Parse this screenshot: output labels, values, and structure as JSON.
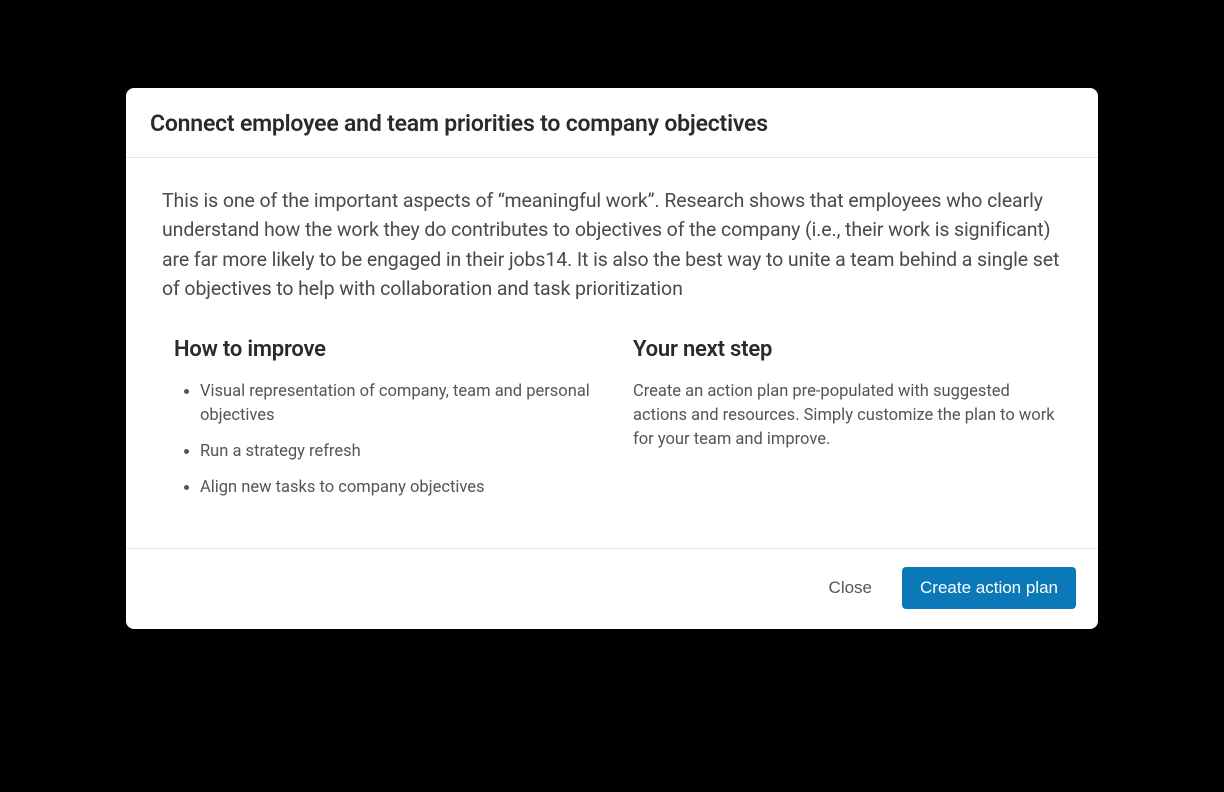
{
  "modal": {
    "title": "Connect employee and team priorities to company objectives",
    "intro": "This is one of the important aspects of “meaningful work”. Research shows that employees who clearly understand how the work they do contributes to objectives of the company (i.e., their work is significant) are far more likely to be engaged in their jobs14. It is also the best way to unite a team behind a single set of objectives to help with collaboration and task prioritization",
    "improve": {
      "heading": "How to improve",
      "items": [
        "Visual representation of company, team and personal objectives",
        "Run a strategy refresh",
        "Align new tasks to company objectives"
      ]
    },
    "next": {
      "heading": "Your next step",
      "body": "Create an action plan pre-populated with suggested actions and resources. Simply customize the plan to work for your team and improve."
    },
    "footer": {
      "close": "Close",
      "primary": "Create action plan"
    }
  }
}
